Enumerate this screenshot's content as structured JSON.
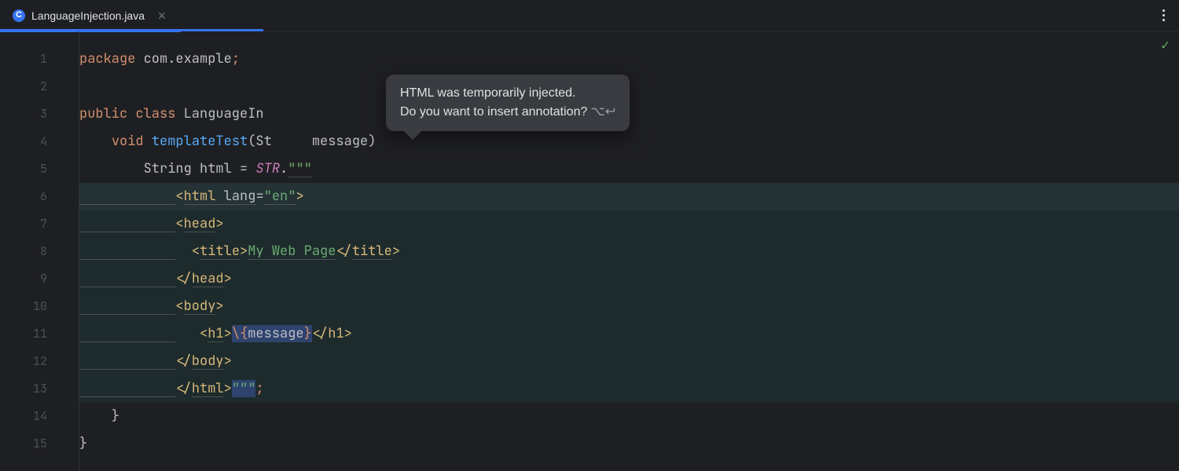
{
  "tab": {
    "icon_letter": "C",
    "filename": "LanguageInjection.java"
  },
  "popup": {
    "line1": "HTML was temporarily injected.",
    "line2": "Do you want to insert annotation?",
    "shortcut": "⌥↩"
  },
  "gutter": {
    "lines": [
      "1",
      "2",
      "3",
      "4",
      "5",
      "6",
      "7",
      "8",
      "9",
      "10",
      "11",
      "12",
      "13",
      "14",
      "15"
    ]
  },
  "code": {
    "l1_package_kw": "package",
    "l1_pkg": "com.example",
    "l3_public": "public",
    "l3_class": "class",
    "l3_name": "LanguageIn",
    "l4_void": "void",
    "l4_method": "templateTest",
    "l4_params_frag": "(St     message)  ",
    "l5_type": "String",
    "l5_var": "html",
    "l5_eq": " = ",
    "l5_STR": "STR",
    "l5_dot": ".",
    "l5_tripleq": "\"\"\"",
    "l6_ws": "            ",
    "l6_open": "<",
    "l6_tag": "html",
    "l6_sp": " ",
    "l6_attr": "lang",
    "l6_eq": "=",
    "l6_val": "\"en\"",
    "l6_close": ">",
    "l7_open": "<",
    "l7_tag": "head",
    "l7_close": ">",
    "l8_o1": "<",
    "l8_t1": "title",
    "l8_c1": ">",
    "l8_text": "My Web Page",
    "l8_o2": "</",
    "l8_t2": "title",
    "l8_c2": ">",
    "l9_o": "</",
    "l9_t": "head",
    "l9_c": ">",
    "l10_o": "<",
    "l10_t": "body",
    "l10_c": ">",
    "l11_o1": "<",
    "l11_t1": "h1",
    "l11_c1": ">",
    "l11_expr_open": "\\{",
    "l11_expr_var": "message",
    "l11_expr_close": "}",
    "l11_o2": "</",
    "l11_t2": "h1",
    "l11_c2": ">",
    "l12_o": "</",
    "l12_t": "body",
    "l12_c": ">",
    "l13_o": "</",
    "l13_t": "html",
    "l13_c": ">",
    "l13_tripleq": "\"\"\"",
    "l13_semi": ";",
    "l14_brace": "}",
    "l15_brace": "}"
  }
}
